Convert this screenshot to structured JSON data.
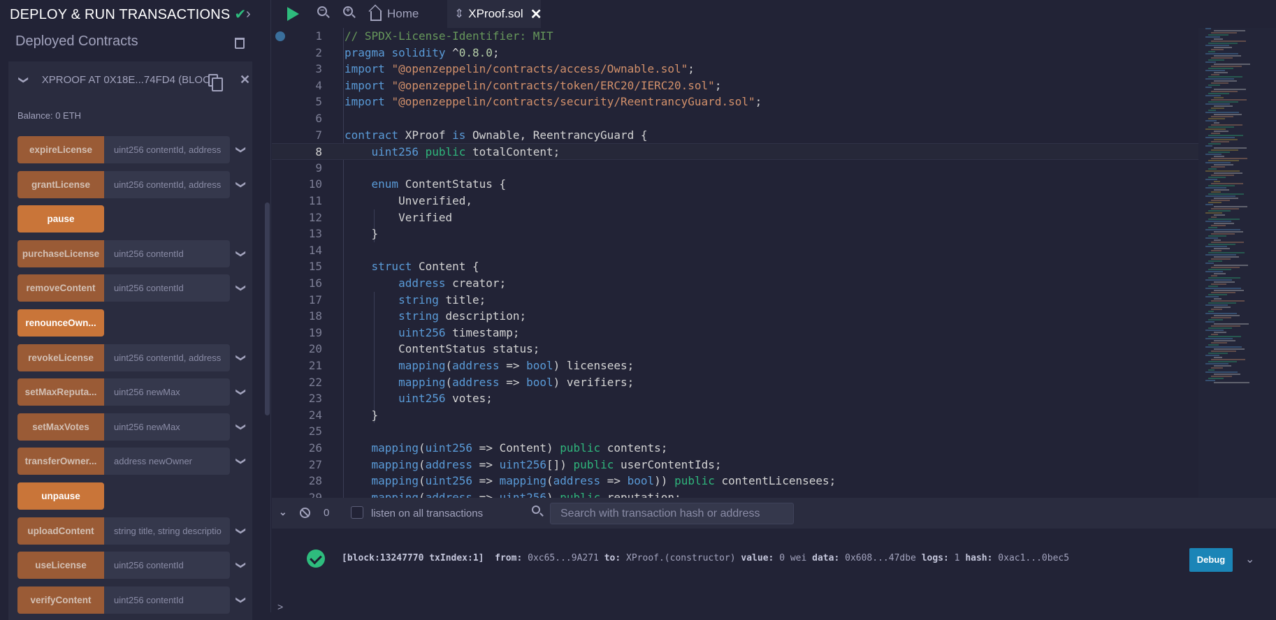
{
  "sidebar": {
    "title": "DEPLOY & RUN TRANSACTIONS",
    "section": "Deployed Contracts",
    "contract": "XPROOF AT 0X18E...74FD4 (BLOC",
    "balance": "Balance: 0 ETH",
    "functions": [
      {
        "name": "expireLicense",
        "params": "uint256 contentId, address",
        "solo": false
      },
      {
        "name": "grantLicense",
        "params": "uint256 contentId, address",
        "solo": false
      },
      {
        "name": "pause",
        "params": "",
        "solo": true
      },
      {
        "name": "purchaseLicense",
        "params": "uint256 contentId",
        "solo": false
      },
      {
        "name": "removeContent",
        "params": "uint256 contentId",
        "solo": false
      },
      {
        "name": "renounceOwn...",
        "params": "",
        "solo": true
      },
      {
        "name": "revokeLicense",
        "params": "uint256 contentId, address",
        "solo": false
      },
      {
        "name": "setMaxReputa...",
        "params": "uint256 newMax",
        "solo": false
      },
      {
        "name": "setMaxVotes",
        "params": "uint256 newMax",
        "solo": false
      },
      {
        "name": "transferOwner...",
        "params": "address newOwner",
        "solo": false
      },
      {
        "name": "unpause",
        "params": "",
        "solo": true
      },
      {
        "name": "uploadContent",
        "params": "string title, string descriptio",
        "solo": false
      },
      {
        "name": "useLicense",
        "params": "uint256 contentId",
        "solo": false
      },
      {
        "name": "verifyContent",
        "params": "uint256 contentId",
        "solo": false
      }
    ]
  },
  "tabs": {
    "home": "Home",
    "file": "XProof.sol"
  },
  "editor": {
    "current_line": 8,
    "lines": [
      [
        [
          "cm",
          "// SPDX-License-Identifier: MIT"
        ]
      ],
      [
        [
          "kw",
          "pragma"
        ],
        [
          "tx",
          " "
        ],
        [
          "kw",
          "solidity"
        ],
        [
          "tx",
          " ^"
        ],
        [
          "num",
          "0.8.0"
        ],
        [
          "tx",
          ";"
        ]
      ],
      [
        [
          "kw",
          "import"
        ],
        [
          "tx",
          " "
        ],
        [
          "str",
          "\"@openzeppelin/contracts/access/Ownable.sol\""
        ],
        [
          "tx",
          ";"
        ]
      ],
      [
        [
          "kw",
          "import"
        ],
        [
          "tx",
          " "
        ],
        [
          "str",
          "\"@openzeppelin/contracts/token/ERC20/IERC20.sol\""
        ],
        [
          "tx",
          ";"
        ]
      ],
      [
        [
          "kw",
          "import"
        ],
        [
          "tx",
          " "
        ],
        [
          "str",
          "\"@openzeppelin/contracts/security/ReentrancyGuard.sol\""
        ],
        [
          "tx",
          ";"
        ]
      ],
      [],
      [
        [
          "kw",
          "contract"
        ],
        [
          "tx",
          " XProof "
        ],
        [
          "kw",
          "is"
        ],
        [
          "tx",
          " Ownable, ReentrancyGuard {"
        ]
      ],
      [
        [
          "tx",
          "    "
        ],
        [
          "kw",
          "uint256"
        ],
        [
          "tx",
          " "
        ],
        [
          "pub",
          "public"
        ],
        [
          "tx",
          " totalContent;"
        ]
      ],
      [],
      [
        [
          "tx",
          "    "
        ],
        [
          "kw",
          "enum"
        ],
        [
          "tx",
          " ContentStatus {"
        ]
      ],
      [
        [
          "tx",
          "        Unverified,"
        ]
      ],
      [
        [
          "tx",
          "        Verified"
        ]
      ],
      [
        [
          "tx",
          "    }"
        ]
      ],
      [],
      [
        [
          "tx",
          "    "
        ],
        [
          "kw",
          "struct"
        ],
        [
          "tx",
          " Content {"
        ]
      ],
      [
        [
          "tx",
          "        "
        ],
        [
          "kw",
          "address"
        ],
        [
          "tx",
          " creator;"
        ]
      ],
      [
        [
          "tx",
          "        "
        ],
        [
          "kw",
          "string"
        ],
        [
          "tx",
          " title;"
        ]
      ],
      [
        [
          "tx",
          "        "
        ],
        [
          "kw",
          "string"
        ],
        [
          "tx",
          " description;"
        ]
      ],
      [
        [
          "tx",
          "        "
        ],
        [
          "kw",
          "uint256"
        ],
        [
          "tx",
          " timestamp;"
        ]
      ],
      [
        [
          "tx",
          "        ContentStatus status;"
        ]
      ],
      [
        [
          "tx",
          "        "
        ],
        [
          "kw",
          "mapping"
        ],
        [
          "tx",
          "("
        ],
        [
          "kw",
          "address"
        ],
        [
          "tx",
          " => "
        ],
        [
          "kw",
          "bool"
        ],
        [
          "tx",
          ") licensees;"
        ]
      ],
      [
        [
          "tx",
          "        "
        ],
        [
          "kw",
          "mapping"
        ],
        [
          "tx",
          "("
        ],
        [
          "kw",
          "address"
        ],
        [
          "tx",
          " => "
        ],
        [
          "kw",
          "bool"
        ],
        [
          "tx",
          ") verifiers;"
        ]
      ],
      [
        [
          "tx",
          "        "
        ],
        [
          "kw",
          "uint256"
        ],
        [
          "tx",
          " votes;"
        ]
      ],
      [
        [
          "tx",
          "    }"
        ]
      ],
      [],
      [
        [
          "tx",
          "    "
        ],
        [
          "kw",
          "mapping"
        ],
        [
          "tx",
          "("
        ],
        [
          "kw",
          "uint256"
        ],
        [
          "tx",
          " => Content) "
        ],
        [
          "pub",
          "public"
        ],
        [
          "tx",
          " contents;"
        ]
      ],
      [
        [
          "tx",
          "    "
        ],
        [
          "kw",
          "mapping"
        ],
        [
          "tx",
          "("
        ],
        [
          "kw",
          "address"
        ],
        [
          "tx",
          " => "
        ],
        [
          "kw",
          "uint256"
        ],
        [
          "tx",
          "[]) "
        ],
        [
          "pub",
          "public"
        ],
        [
          "tx",
          " userContentIds;"
        ]
      ],
      [
        [
          "tx",
          "    "
        ],
        [
          "kw",
          "mapping"
        ],
        [
          "tx",
          "("
        ],
        [
          "kw",
          "uint256"
        ],
        [
          "tx",
          " => "
        ],
        [
          "kw",
          "mapping"
        ],
        [
          "tx",
          "("
        ],
        [
          "kw",
          "address"
        ],
        [
          "tx",
          " => "
        ],
        [
          "kw",
          "bool"
        ],
        [
          "tx",
          ")) "
        ],
        [
          "pub",
          "public"
        ],
        [
          "tx",
          " contentLicensees;"
        ]
      ],
      [
        [
          "tx",
          "    "
        ],
        [
          "kw",
          "mapping"
        ],
        [
          "tx",
          "("
        ],
        [
          "kw",
          "address"
        ],
        [
          "tx",
          " => "
        ],
        [
          "kw",
          "uint256"
        ],
        [
          "tx",
          ") "
        ],
        [
          "pub",
          "public"
        ],
        [
          "tx",
          " reputation;"
        ]
      ]
    ]
  },
  "terminal": {
    "count": "0",
    "listen_label": "listen on all transactions",
    "search_placeholder": "Search with transaction hash or address",
    "tx": {
      "block": "[block:13247770 txIndex:1]",
      "from_label": "from:",
      "from": "0xc65...9A271",
      "to_label": "to:",
      "to": "XProof.(constructor)",
      "value_label": "value:",
      "value": "0 wei",
      "data_label": "data:",
      "data": "0x608...47dbe",
      "logs_label": "logs:",
      "logs": "1",
      "hash_label": "hash:",
      "hash": "0xac1...0bec5"
    },
    "debug_label": "Debug",
    "prompt": ">"
  },
  "colors": {
    "accent": "#c97539",
    "success": "#2ebc7d",
    "debug": "#1b85b7"
  }
}
